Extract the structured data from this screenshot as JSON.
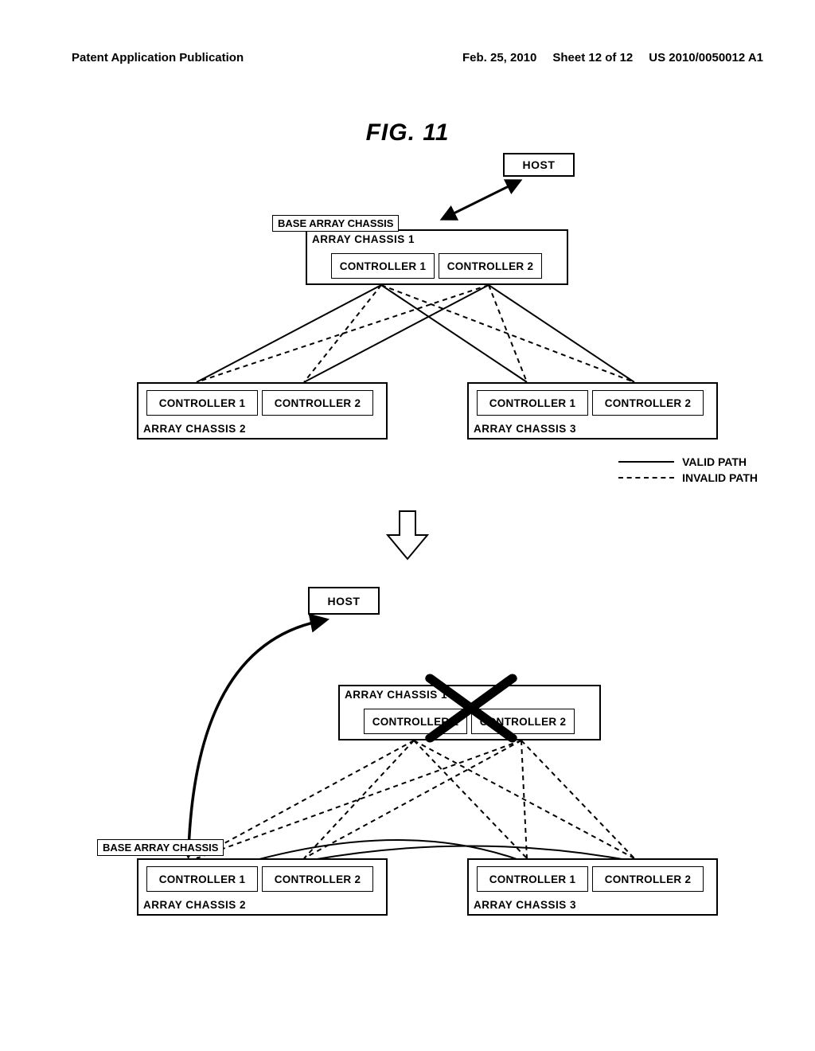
{
  "header": {
    "left": "Patent Application Publication",
    "date": "Feb. 25, 2010",
    "sheet": "Sheet 12 of 12",
    "pubno": "US 2010/0050012 A1"
  },
  "figure_title": "FIG. 11",
  "labels": {
    "host": "HOST",
    "base_array_chassis": "BASE ARRAY CHASSIS",
    "array_chassis_1": "ARRAY CHASSIS 1",
    "array_chassis_2": "ARRAY CHASSIS 2",
    "array_chassis_3": "ARRAY CHASSIS 3",
    "controller_1": "CONTROLLER 1",
    "controller_2": "CONTROLLER 2",
    "valid_path": "VALID PATH",
    "invalid_path": "INVALID PATH"
  }
}
